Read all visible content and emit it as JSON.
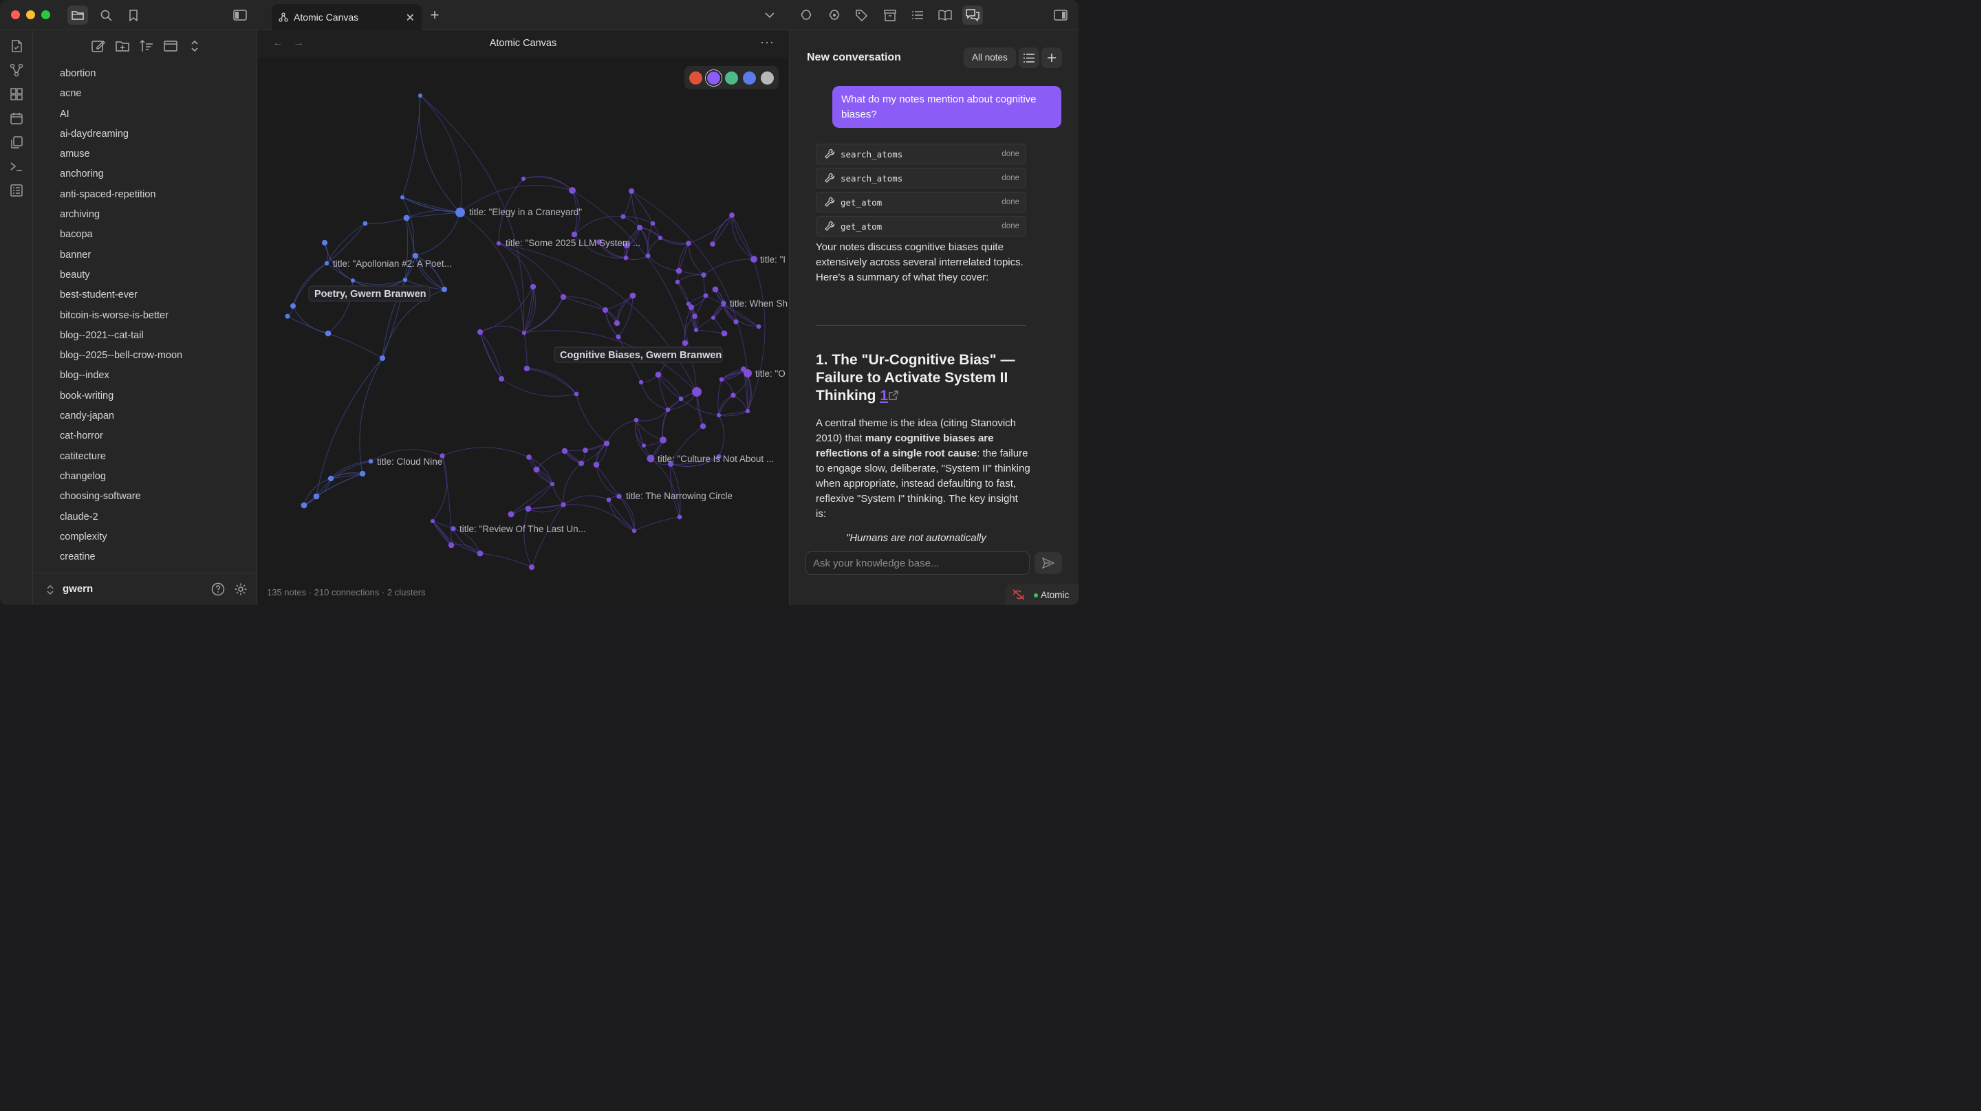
{
  "window": {
    "tab_title": "Atomic Canvas",
    "traffic_lights": [
      "#ff5f57",
      "#febc2e",
      "#28c840"
    ]
  },
  "rail": {
    "icons": [
      "notes-icon",
      "graph-icon",
      "grid-icon",
      "calendar-icon",
      "copy-icon",
      "terminal-icon",
      "list-layout-icon"
    ]
  },
  "tags": {
    "items": [
      "abortion",
      "acne",
      "AI",
      "ai-daydreaming",
      "amuse",
      "anchoring",
      "anti-spaced-repetition",
      "archiving",
      "bacopa",
      "banner",
      "beauty",
      "best-student-ever",
      "bitcoin-is-worse-is-better",
      "blog--2021--cat-tail",
      "blog--2025--bell-crow-moon",
      "blog--index",
      "book-writing",
      "candy-japan",
      "cat-horror",
      "catitecture",
      "changelog",
      "choosing-software",
      "claude-2",
      "complexity",
      "creatine"
    ],
    "user": "gwern"
  },
  "canvas": {
    "title": "Atomic Canvas",
    "stats": "135 notes · 210 connections · 2 clusters",
    "swatches": [
      "#e0523a",
      "#8b5cf6",
      "#4dba8a",
      "#5b7be8",
      "#b8b8b8"
    ],
    "selected_swatch": 1,
    "cluster_labels": [
      "Poetry, Gwern Branwen",
      "Cognitive Biases, Gwern Branwen"
    ],
    "node_labels": [
      "title: \"Elegy in a Craneyard\"",
      "title: \"Some 2025 LLM System ...",
      "title: \"Apollonian #2: A Poet...",
      "title: \"I",
      "title: When Sh",
      "title: \"O",
      "title: Cloud Nine",
      "title: \"Culture Is Not About ...",
      "title: The Narrowing Circle",
      "title: \"Review Of The Last Un..."
    ]
  },
  "chat": {
    "title": "New conversation",
    "all_notes": "All notes",
    "user_message": "What do my notes mention about cognitive biases?",
    "tool_calls": [
      {
        "name": "search_atoms",
        "status": "done"
      },
      {
        "name": "search_atoms",
        "status": "done"
      },
      {
        "name": "get_atom",
        "status": "done"
      },
      {
        "name": "get_atom",
        "status": "done"
      }
    ],
    "intro": "Your notes discuss cognitive biases quite extensively across several interrelated topics. Here's a summary of what they cover:",
    "heading": "1. The \"Ur-Cognitive Bias\" — Failure to Activate System II Thinking",
    "heading_cite": "1",
    "para_a": "A central theme is the idea (citing Stanovich 2010) that ",
    "para_bold": "many cognitive biases are reflections of a single root cause",
    "para_b": ": the failure to engage slow, deliberate, \"System II\" thinking when appropriate, instead defaulting to fast, reflexive \"System I\" thinking. The key insight is:",
    "quote": "\"Humans are not automatically",
    "input_placeholder": "Ask your knowledge base...",
    "status": "Atomic"
  }
}
